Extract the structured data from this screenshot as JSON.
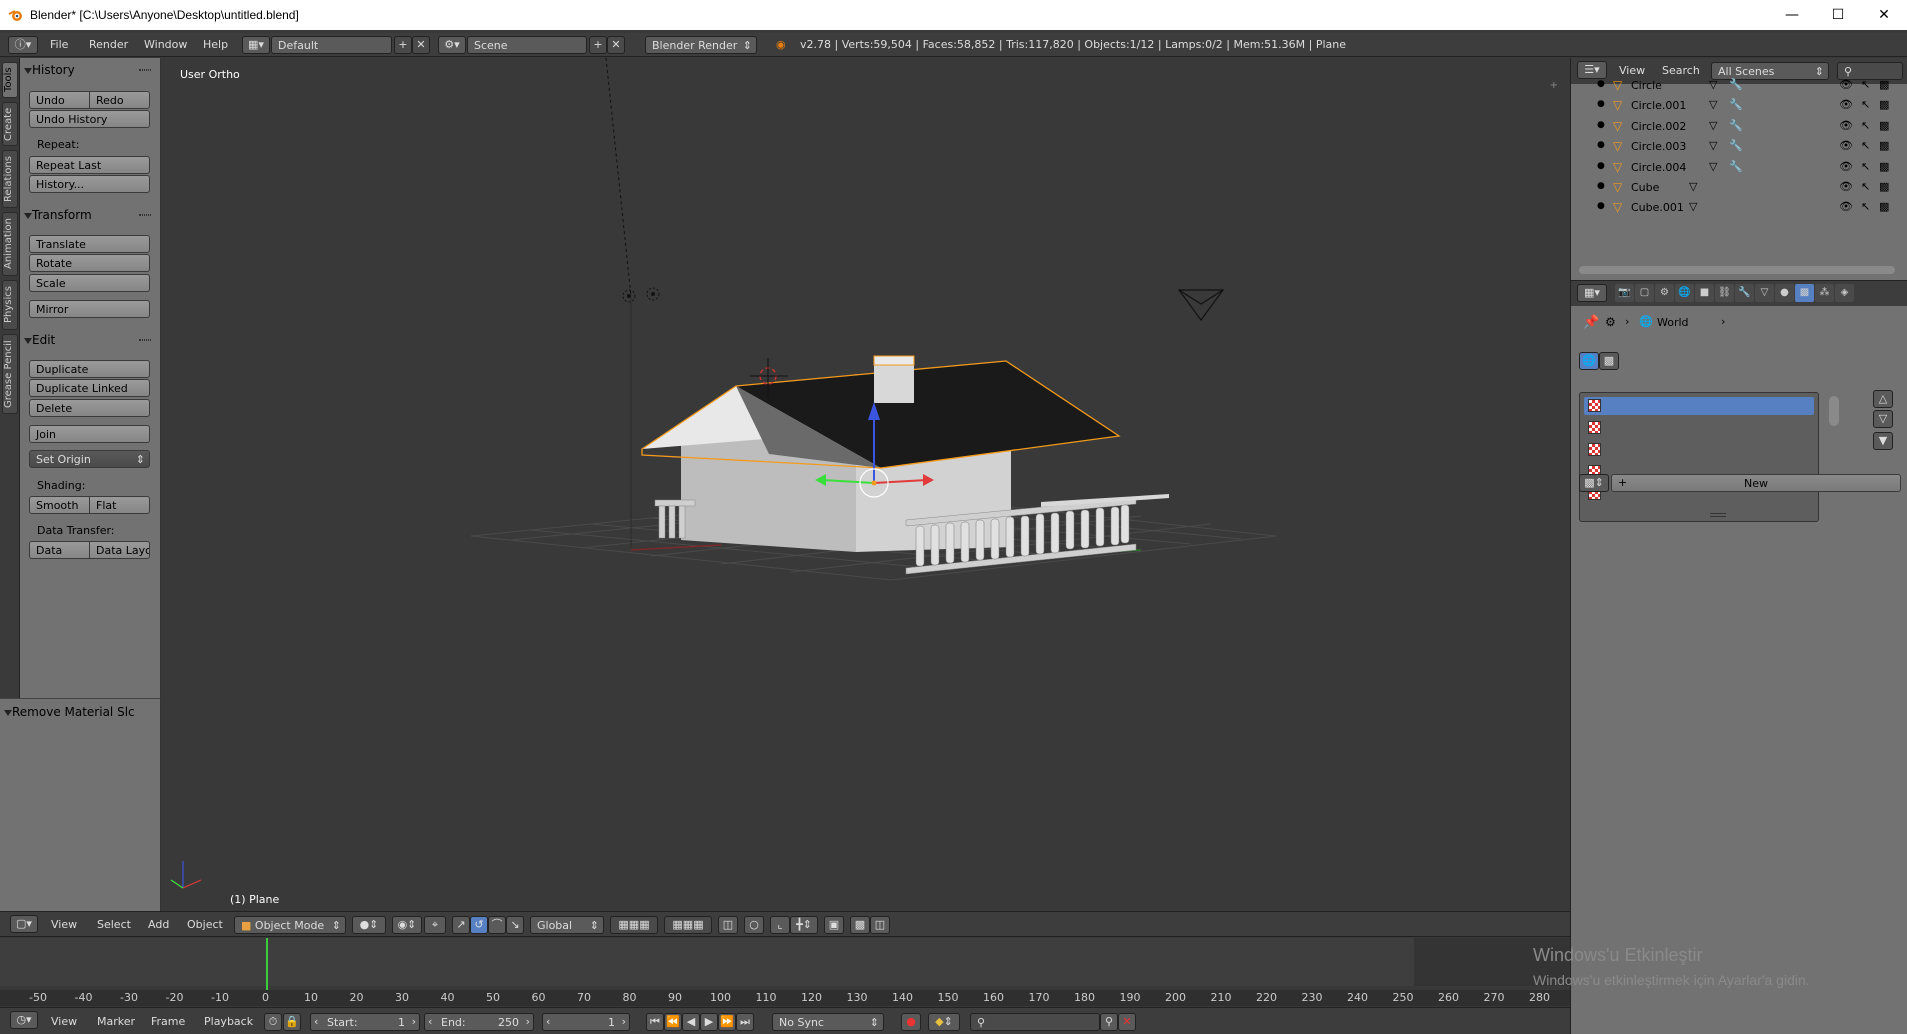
{
  "window": {
    "title": "Blender* [C:\\Users\\Anyone\\Desktop\\untitled.blend]",
    "minimize_icon": "minimize-icon",
    "maximize_icon": "maximize-icon",
    "close_icon": "close-icon"
  },
  "info_header": {
    "menus": [
      "File",
      "Render",
      "Window",
      "Help"
    ],
    "layout": "Default",
    "scene": "Scene",
    "engine": "Blender Render",
    "stats": "v2.78 | Verts:59,504 | Faces:58,852 | Tris:117,820 | Objects:1/12 | Lamps:0/2 | Mem:51.36M | Plane"
  },
  "tool_tabs": [
    "Tools",
    "Create",
    "Relations",
    "Animation",
    "Physics",
    "Grease Pencil"
  ],
  "tool_shelf": {
    "history": {
      "title": "History",
      "undo": "Undo",
      "redo": "Redo",
      "undo_history": "Undo History",
      "repeat_label": "Repeat:",
      "repeat_last": "Repeat Last",
      "history_btn": "History..."
    },
    "transform": {
      "title": "Transform",
      "translate": "Translate",
      "rotate": "Rotate",
      "scale": "Scale",
      "mirror": "Mirror"
    },
    "edit": {
      "title": "Edit",
      "duplicate": "Duplicate",
      "duplicate_linked": "Duplicate Linked",
      "delete": "Delete",
      "join": "Join",
      "set_origin": "Set Origin",
      "shading_label": "Shading:",
      "smooth": "Smooth",
      "flat": "Flat",
      "data_transfer_label": "Data Transfer:",
      "data": "Data",
      "data_layout": "Data Layo"
    }
  },
  "operator_panel": {
    "title": "Remove Material Slc"
  },
  "viewport": {
    "view_label": "User Ortho",
    "object_label": "(1) Plane"
  },
  "viewport_header": {
    "menus": [
      "View",
      "Select",
      "Add",
      "Object"
    ],
    "mode": "Object Mode",
    "orientation": "Global"
  },
  "timeline": {
    "ruler": [
      "-50",
      "-40",
      "-30",
      "-20",
      "-10",
      "0",
      "10",
      "20",
      "30",
      "40",
      "50",
      "60",
      "70",
      "80",
      "90",
      "100",
      "110",
      "120",
      "130",
      "140",
      "150",
      "160",
      "170",
      "180",
      "190",
      "200",
      "210",
      "220",
      "230",
      "240",
      "250",
      "260",
      "270",
      "280"
    ],
    "current_frame_marker": 0
  },
  "timeline_header": {
    "menus": [
      "View",
      "Marker",
      "Frame",
      "Playback"
    ],
    "start_label": "Start:",
    "start_value": "1",
    "end_label": "End:",
    "end_value": "250",
    "current_frame": "1",
    "sync": "No Sync"
  },
  "outliner": {
    "menus": [
      "View",
      "Search"
    ],
    "filter": "All Scenes",
    "rows": [
      {
        "name": "Circle",
        "modifier": true
      },
      {
        "name": "Circle.001",
        "modifier": true
      },
      {
        "name": "Circle.002",
        "modifier": true
      },
      {
        "name": "Circle.003",
        "modifier": true
      },
      {
        "name": "Circle.004",
        "modifier": true
      },
      {
        "name": "Cube",
        "modifier": false
      },
      {
        "name": "Cube.001",
        "modifier": false
      }
    ]
  },
  "properties": {
    "breadcrumb_world": "World",
    "new_button": "New",
    "texture_slots": 5
  },
  "windows_activation": {
    "line1": "Windows'u Etkinleştir",
    "line2": "Windows'u etkinleştirmek için Ayarlar'a gidin."
  },
  "colors": {
    "selection_outline": "#f39a1c",
    "slot_selected": "#5680c2",
    "frame_marker": "#3ccc3c"
  }
}
